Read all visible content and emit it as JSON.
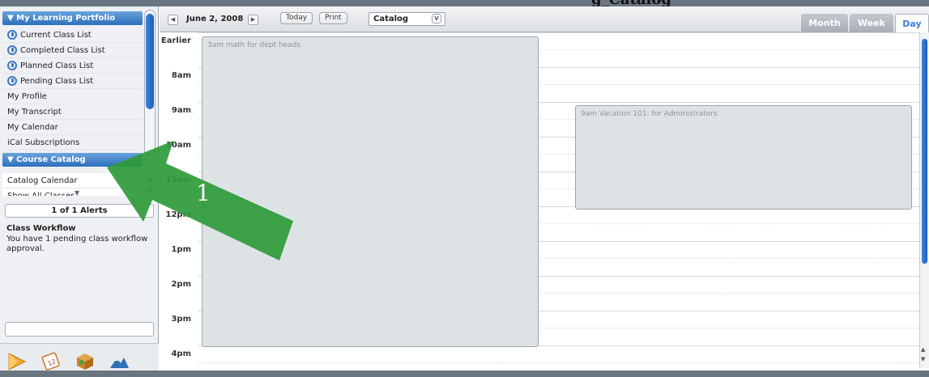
{
  "title_fragment": "g_Catalog",
  "sidebar": {
    "portfolio_header": "▼ My Learning Portfolio",
    "portfolio_items": [
      {
        "label": "Current Class List",
        "icon": "class-icon"
      },
      {
        "label": "Completed Class List",
        "icon": "class-icon"
      },
      {
        "label": "Planned Class List",
        "icon": "class-icon"
      },
      {
        "label": "Pending Class List",
        "icon": "class-icon"
      },
      {
        "label": "My Profile"
      },
      {
        "label": "My Transcript"
      },
      {
        "label": "My Calendar"
      },
      {
        "label": "iCal Subscriptions"
      }
    ],
    "catalog_header": "▼ Course Catalog",
    "catalog_items": [
      {
        "label": "Catalog Calendar"
      },
      {
        "label": "Show All Classes"
      }
    ],
    "alerts_counter": "1 of 1 Alerts",
    "alert_title": "Class Workflow",
    "alert_body": "You have 1 pending class workflow approval.",
    "bottom_icons": [
      "learning-icon",
      "calendar-icon",
      "catalog-icon",
      "analytics-icon"
    ]
  },
  "calendar": {
    "date": "June 2, 2008",
    "today_label": "Today",
    "print_label": "Print",
    "catalog_select": "Catalog",
    "view_tabs": {
      "month": "Month",
      "week": "Week",
      "day": "Day",
      "active": "Day"
    },
    "time_labels": [
      "Earlier",
      "8am",
      "9am",
      "10am",
      "11am",
      "12pm",
      "1pm",
      "2pm",
      "3pm",
      "4pm"
    ],
    "events": [
      {
        "text": "3am  math for dept heads"
      },
      {
        "text": "9am  Vacation 101: for Administrators"
      }
    ]
  },
  "annotation": {
    "number": "1",
    "color": "#2e9a3a"
  }
}
